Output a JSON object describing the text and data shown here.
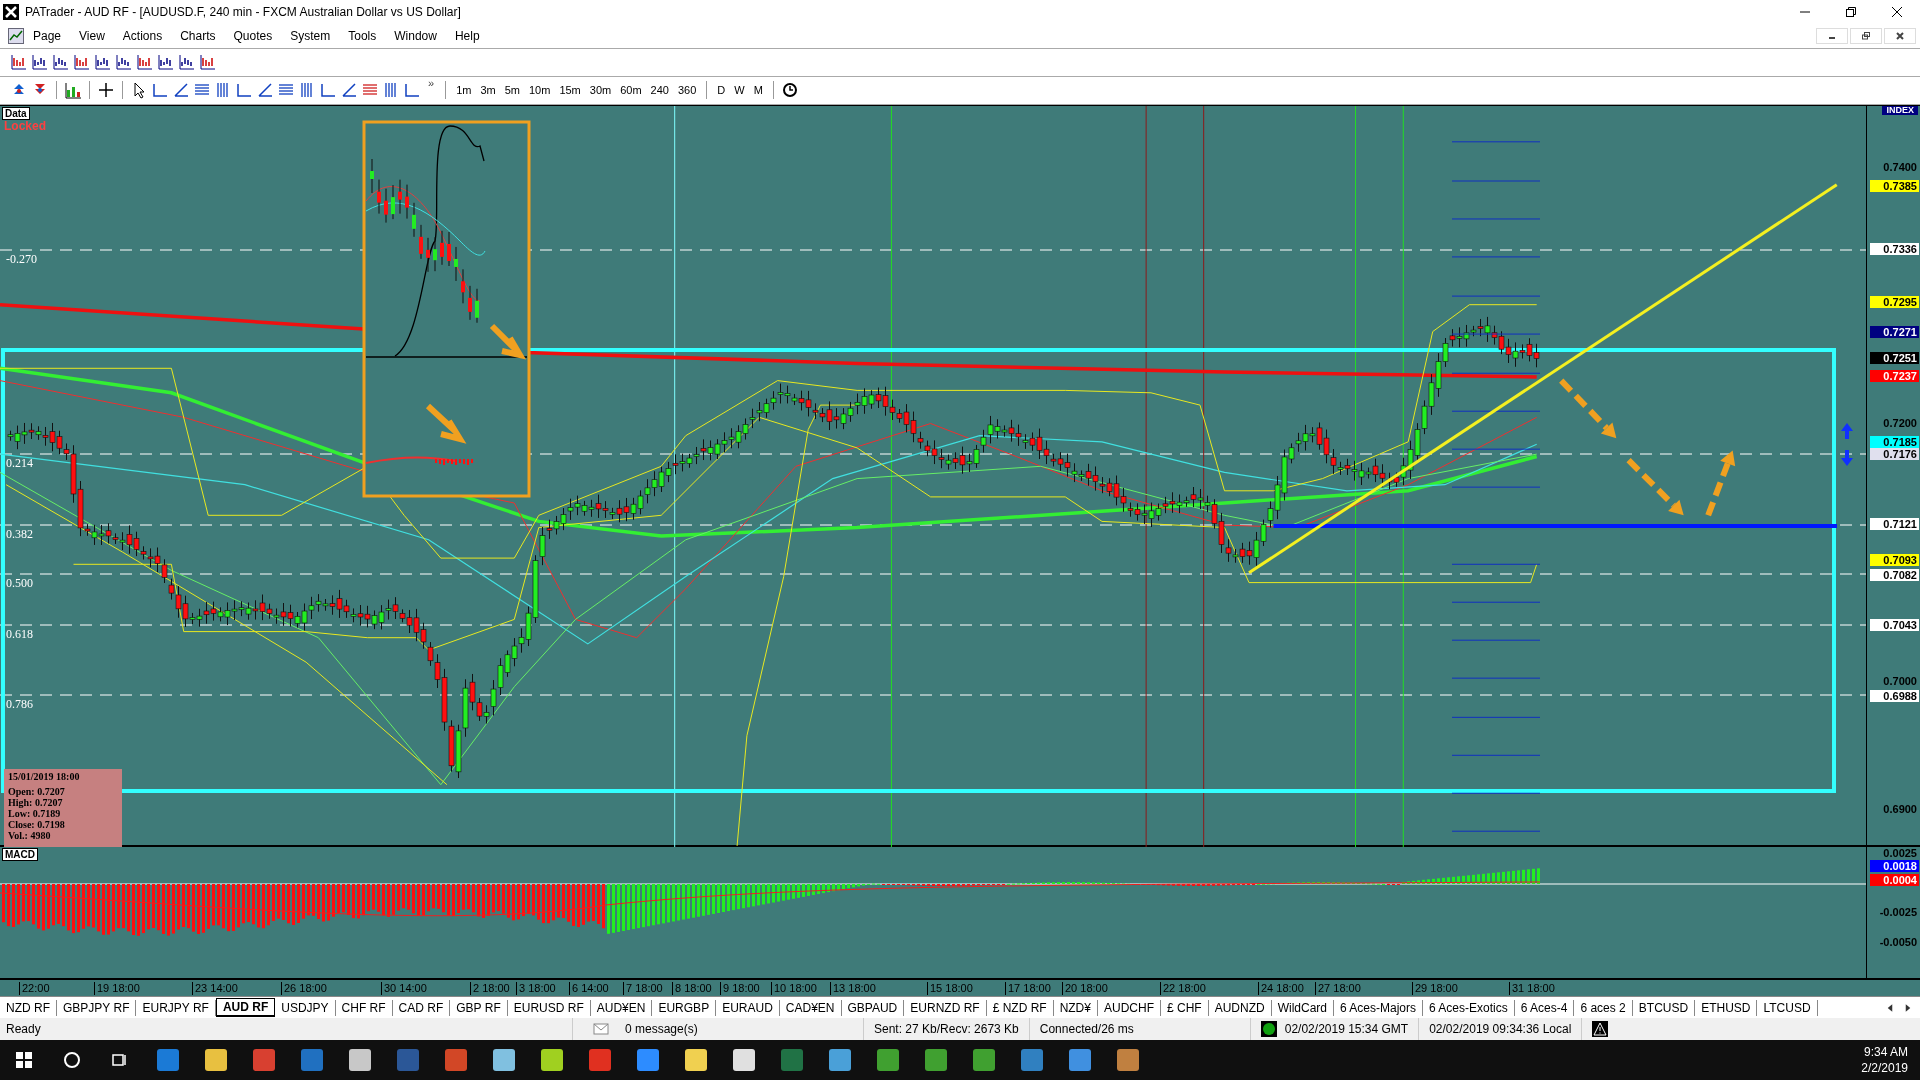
{
  "window": {
    "title": "PATrader - AUD RF - [AUDUSD.F, 240 min - FXCM Australian Dollar vs US Dollar]"
  },
  "menu": [
    "Page",
    "View",
    "Actions",
    "Charts",
    "Quotes",
    "System",
    "Tools",
    "Window",
    "Help"
  ],
  "toolbar": {
    "overflow": "»",
    "timeframes": [
      "1m",
      "3m",
      "5m",
      "10m",
      "15m",
      "30m",
      "60m",
      "240",
      "360"
    ],
    "periods": [
      "D",
      "W",
      "M"
    ]
  },
  "chart": {
    "data_label": "Data",
    "lock_label": "Locked",
    "top_tag": "INDEX",
    "fib_levels": [
      "-0.270",
      "0.214",
      "0.382",
      "0.500",
      "0.618",
      "0.786"
    ],
    "price_axis": [
      {
        "text": "0.7400",
        "kind": "tick"
      },
      {
        "text": "0.7385",
        "kind": "marker",
        "color": "#ffff00"
      },
      {
        "text": "0.7336",
        "kind": "marker",
        "color": "#ffffff"
      },
      {
        "text": "0.7295",
        "kind": "marker",
        "color": "#ffff00"
      },
      {
        "text": "0.7271",
        "kind": "marker",
        "color": "#000080"
      },
      {
        "text": "0.7251",
        "kind": "marker",
        "color": "#000000"
      },
      {
        "text": "0.7237",
        "kind": "marker",
        "color": "#ff0000"
      },
      {
        "text": "0.7200",
        "kind": "tick"
      },
      {
        "text": "0.7185",
        "kind": "marker",
        "color": "#00ffff"
      },
      {
        "text": "0.7176",
        "kind": "marker",
        "color": "#e0e0ee"
      },
      {
        "text": "0.7121",
        "kind": "marker",
        "color": "#ffffff"
      },
      {
        "text": "0.7093",
        "kind": "marker",
        "color": "#ffff00"
      },
      {
        "text": "0.7082",
        "kind": "marker",
        "color": "#ffffff"
      },
      {
        "text": "0.7043",
        "kind": "marker",
        "color": "#ffffff"
      },
      {
        "text": "0.7000",
        "kind": "tick"
      },
      {
        "text": "0.6988",
        "kind": "marker",
        "color": "#ffffff"
      },
      {
        "text": "0.6900",
        "kind": "tick"
      }
    ],
    "ohlc_box": {
      "date": "15/01/2019 18:00",
      "lines": [
        "Open: 0.7207",
        "High: 0.7207",
        "Low: 0.7189",
        "Close: 0.7198",
        "Vol.: 4980"
      ]
    }
  },
  "macd": {
    "label": "MACD",
    "axis": [
      {
        "text": "0.0025",
        "kind": "tick"
      },
      {
        "text": "0.0018",
        "kind": "marker",
        "color": "#0000ff"
      },
      {
        "text": "0.0004",
        "kind": "marker",
        "color": "#ff0000"
      },
      {
        "text": "-0.0025",
        "kind": "tick"
      },
      {
        "text": "-0.0050",
        "kind": "tick"
      }
    ]
  },
  "time_axis": [
    "22:00",
    "19 18:00",
    "23 14:00",
    "26 18:00",
    "30 14:00",
    "2 18:00",
    "3 18:00",
    "6 14:00",
    "7 18:00",
    "8 18:00",
    "9 18:00",
    "10 18:00",
    "13 18:00",
    "15 18:00",
    "17 18:00",
    "20 18:00",
    "22 18:00",
    "24 18:00",
    "27 18:00",
    "29 18:00",
    "31 18:00"
  ],
  "symbol_tabs": [
    {
      "label": "NZD RF",
      "selected": false
    },
    {
      "label": "GBPJPY RF",
      "selected": false
    },
    {
      "label": "EURJPY RF",
      "selected": false
    },
    {
      "label": "AUD RF",
      "selected": true
    },
    {
      "label": "USDJPY",
      "selected": false
    },
    {
      "label": "CHF RF",
      "selected": false
    },
    {
      "label": "CAD RF",
      "selected": false
    },
    {
      "label": "GBP RF",
      "selected": false
    },
    {
      "label": "EURUSD RF",
      "selected": false
    },
    {
      "label": "AUD¥EN",
      "selected": false
    },
    {
      "label": "EURGBP",
      "selected": false
    },
    {
      "label": "EURAUD",
      "selected": false
    },
    {
      "label": "CAD¥EN",
      "selected": false
    },
    {
      "label": "GBPAUD",
      "selected": false
    },
    {
      "label": "EURNZD RF",
      "selected": false
    },
    {
      "label": "£ NZD RF",
      "selected": false
    },
    {
      "label": "NZD¥",
      "selected": false
    },
    {
      "label": "AUDCHF",
      "selected": false
    },
    {
      "label": "£ CHF",
      "selected": false
    },
    {
      "label": "AUDNZD",
      "selected": false
    },
    {
      "label": "WildCard",
      "selected": false
    },
    {
      "label": "6 Aces-Majors",
      "selected": false
    },
    {
      "label": "6 Aces-Exotics",
      "selected": false
    },
    {
      "label": "6 Aces-4",
      "selected": false
    },
    {
      "label": "6 aces 2",
      "selected": false
    },
    {
      "label": "BTCUSD",
      "selected": false
    },
    {
      "label": "ETHUSD",
      "selected": false
    },
    {
      "label": "LTCUSD",
      "selected": false
    }
  ],
  "status_bar": {
    "state": "Ready",
    "messages": "0 message(s)",
    "traffic": "Sent: 27 Kb/Recv: 2673 Kb",
    "connection": "Connected/26 ms",
    "gmt_time": "02/02/2019 15:34 GMT",
    "local_time": "02/02/2019 09:34:36 Local"
  },
  "taskbar": {
    "time": "9:34 AM",
    "date": "2/2/2019"
  }
}
